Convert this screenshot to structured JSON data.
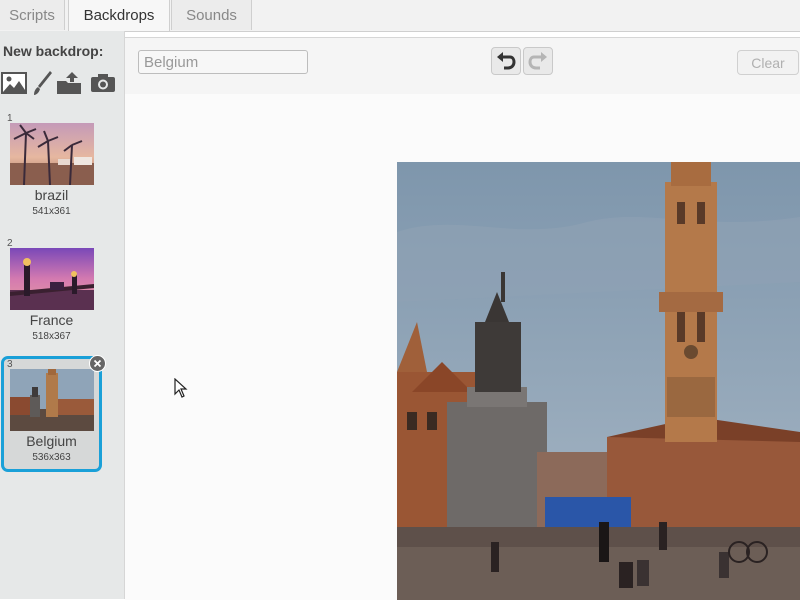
{
  "tabs": [
    {
      "label": "Scripts"
    },
    {
      "label": "Backdrops"
    },
    {
      "label": "Sounds"
    }
  ],
  "new_backdrop": {
    "label": "New backdrop:",
    "tools": [
      "landscape-library-icon",
      "paintbrush-icon",
      "upload-icon",
      "camera-icon"
    ]
  },
  "backdrops": [
    {
      "number": "1",
      "name": "brazil",
      "size": "541x361"
    },
    {
      "number": "2",
      "name": "France",
      "size": "518x367"
    },
    {
      "number": "3",
      "name": "Belgium",
      "size": "536x363"
    }
  ],
  "editor": {
    "name_value": "Belgium",
    "clear_label": "Clear"
  },
  "colors": {
    "selection": "#1aa0d8",
    "sky": "#8fa4b8",
    "stone": "#b07a4a"
  }
}
